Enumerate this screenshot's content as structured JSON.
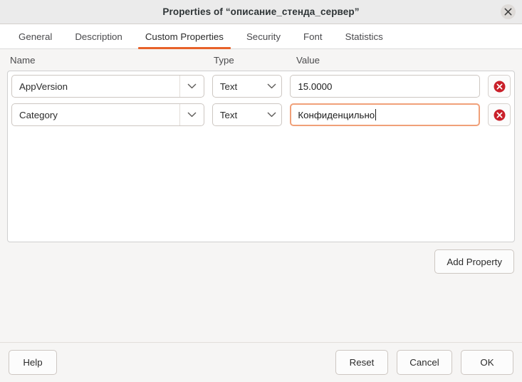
{
  "window": {
    "title": "Properties of “описание_стенда_сервер”",
    "close_label": "✕"
  },
  "tabs": [
    {
      "label": "General",
      "active": false
    },
    {
      "label": "Description",
      "active": false
    },
    {
      "label": "Custom Properties",
      "active": true
    },
    {
      "label": "Security",
      "active": false
    },
    {
      "label": "Font",
      "active": false
    },
    {
      "label": "Statistics",
      "active": false
    }
  ],
  "columns": {
    "name": "Name",
    "type": "Type",
    "value": "Value"
  },
  "properties": [
    {
      "name": "AppVersion",
      "type": "Text",
      "value": "15.0000",
      "focused": false
    },
    {
      "name": "Category",
      "type": "Text",
      "value": "Конфиденцильно",
      "focused": true
    }
  ],
  "buttons": {
    "add_property": "Add Property",
    "help": "Help",
    "reset": "Reset",
    "cancel": "Cancel",
    "ok": "OK"
  },
  "colors": {
    "accent": "#e8622a",
    "focus_border": "#f0a079",
    "delete_icon": "#c9202a",
    "titlebar_bg": "#ebebeb",
    "dialog_bg": "#f6f5f4"
  }
}
